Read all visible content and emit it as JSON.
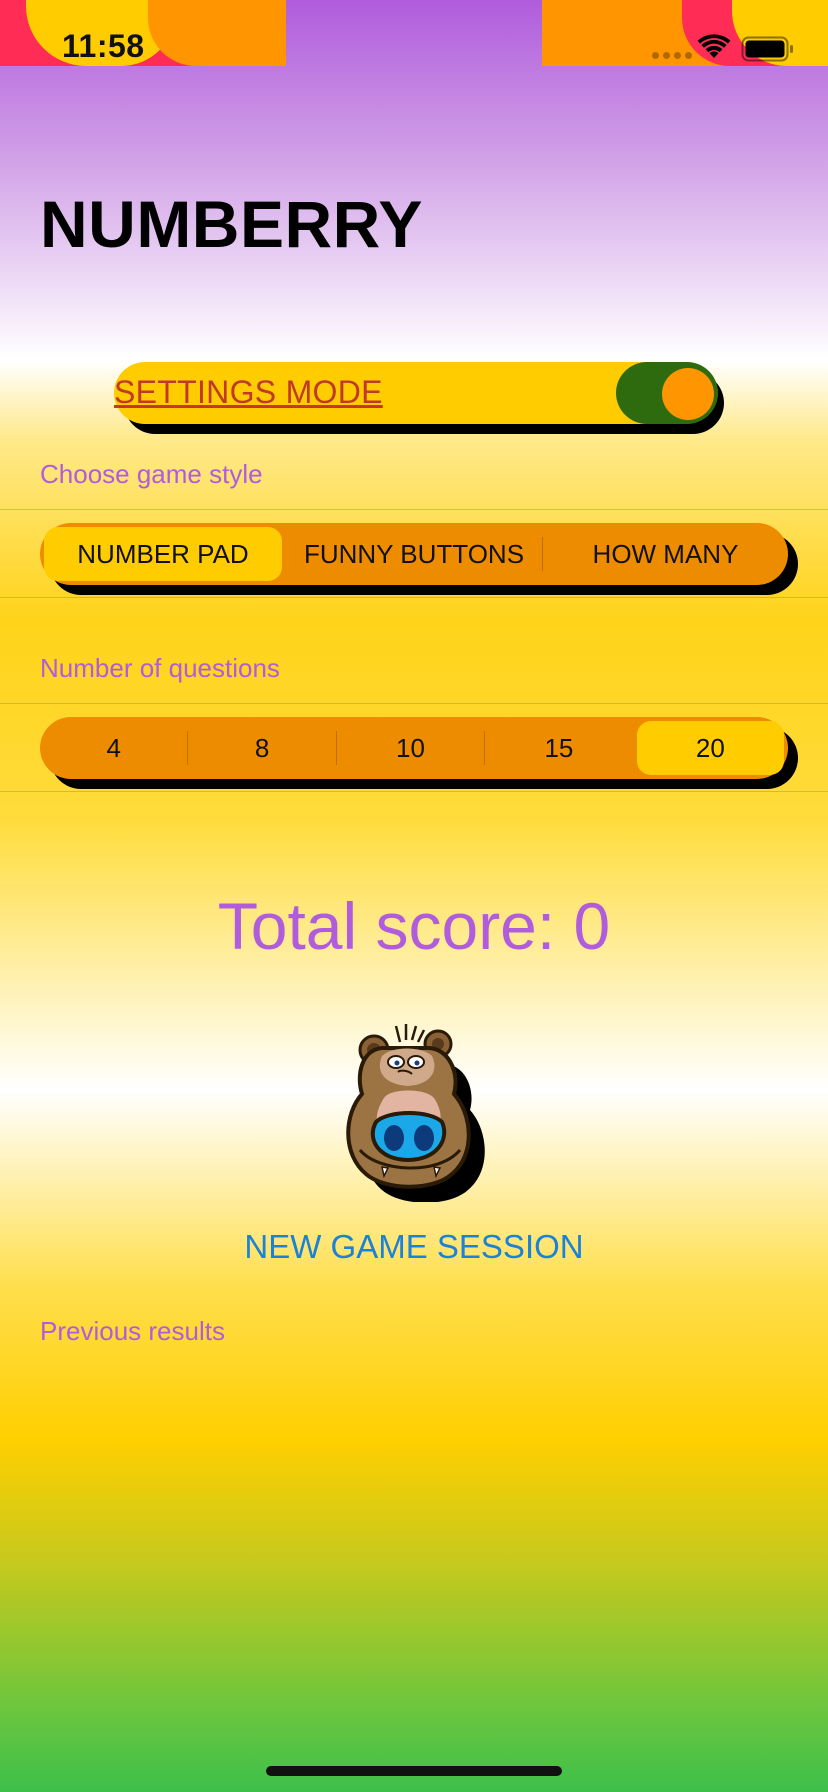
{
  "status_bar": {
    "time": "11:58"
  },
  "app": {
    "title": "NUMBERRY"
  },
  "settings": {
    "label": "SETTINGS MODE",
    "toggle_on": true
  },
  "game_style": {
    "label": "Choose game style",
    "options": [
      "NUMBER PAD",
      "FUNNY BUTTONS",
      "HOW MANY"
    ],
    "selected": "NUMBER PAD"
  },
  "questions": {
    "label": "Number of questions",
    "options": [
      "4",
      "8",
      "10",
      "15",
      "20"
    ],
    "selected": "20"
  },
  "score": {
    "text": "Total score: 0"
  },
  "actions": {
    "new_game": "NEW GAME SESSION"
  },
  "history": {
    "label": "Previous results"
  },
  "colors": {
    "accent_purple": "#b05cdc",
    "toggle_track": "#2e6b0f",
    "toggle_knob": "#ff9500",
    "segment_bg": "#ee8c00",
    "segment_selected": "#ffcc00",
    "link_blue": "#1a82d8",
    "settings_label": "#c0392b"
  },
  "icons": {
    "wifi": "wifi-icon",
    "battery": "battery-icon",
    "mascot": "bear-mascot"
  }
}
